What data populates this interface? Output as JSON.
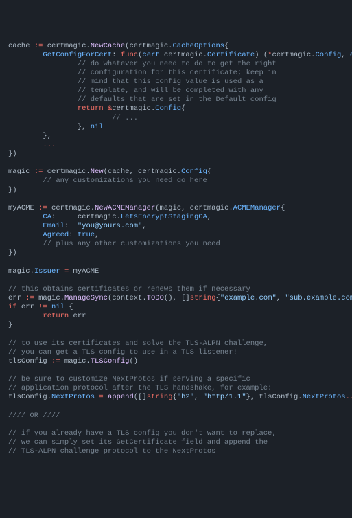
{
  "tokens": [
    {
      "cls": "p",
      "t": "cache "
    },
    {
      "cls": "k",
      "t": ":="
    },
    {
      "cls": "p",
      "t": " certmagic."
    },
    {
      "cls": "fn",
      "t": "NewCache"
    },
    {
      "cls": "p",
      "t": "(certmagic."
    },
    {
      "cls": "v",
      "t": "CacheOptions"
    },
    {
      "cls": "p",
      "t": "{\n"
    },
    {
      "cls": "p",
      "t": "        "
    },
    {
      "cls": "v",
      "t": "GetConfigForCert"
    },
    {
      "cls": "p",
      "t": ": "
    },
    {
      "cls": "k",
      "t": "func"
    },
    {
      "cls": "p",
      "t": "("
    },
    {
      "cls": "v",
      "t": "cert"
    },
    {
      "cls": "p",
      "t": " certmagic."
    },
    {
      "cls": "v",
      "t": "Certificate"
    },
    {
      "cls": "p",
      "t": ") ("
    },
    {
      "cls": "k",
      "t": "*"
    },
    {
      "cls": "p",
      "t": "certmagic."
    },
    {
      "cls": "v",
      "t": "Config"
    },
    {
      "cls": "p",
      "t": ", "
    },
    {
      "cls": "v",
      "t": "error"
    },
    {
      "cls": "p",
      "t": ") {\n"
    },
    {
      "cls": "p",
      "t": "                "
    },
    {
      "cls": "c",
      "t": "// do whatever you need to do to get the right"
    },
    {
      "cls": "p",
      "t": "\n"
    },
    {
      "cls": "p",
      "t": "                "
    },
    {
      "cls": "c",
      "t": "// configuration for this certificate; keep in"
    },
    {
      "cls": "p",
      "t": "\n"
    },
    {
      "cls": "p",
      "t": "                "
    },
    {
      "cls": "c",
      "t": "// mind that this config value is used as a"
    },
    {
      "cls": "p",
      "t": "\n"
    },
    {
      "cls": "p",
      "t": "                "
    },
    {
      "cls": "c",
      "t": "// template, and will be completed with any"
    },
    {
      "cls": "p",
      "t": "\n"
    },
    {
      "cls": "p",
      "t": "                "
    },
    {
      "cls": "c",
      "t": "// defaults that are set in the Default config"
    },
    {
      "cls": "p",
      "t": "\n"
    },
    {
      "cls": "p",
      "t": "                "
    },
    {
      "cls": "k",
      "t": "return"
    },
    {
      "cls": "p",
      "t": " "
    },
    {
      "cls": "k",
      "t": "&"
    },
    {
      "cls": "p",
      "t": "certmagic."
    },
    {
      "cls": "v",
      "t": "Config"
    },
    {
      "cls": "p",
      "t": "{\n"
    },
    {
      "cls": "p",
      "t": "                        "
    },
    {
      "cls": "c",
      "t": "// ..."
    },
    {
      "cls": "p",
      "t": "\n"
    },
    {
      "cls": "p",
      "t": "                }, "
    },
    {
      "cls": "n",
      "t": "nil"
    },
    {
      "cls": "p",
      "t": "\n"
    },
    {
      "cls": "p",
      "t": "        },\n"
    },
    {
      "cls": "p",
      "t": "        "
    },
    {
      "cls": "k",
      "t": "..."
    },
    {
      "cls": "p",
      "t": "\n"
    },
    {
      "cls": "p",
      "t": "})\n"
    },
    {
      "cls": "p",
      "t": "\n"
    },
    {
      "cls": "p",
      "t": "magic "
    },
    {
      "cls": "k",
      "t": ":="
    },
    {
      "cls": "p",
      "t": " certmagic."
    },
    {
      "cls": "fn",
      "t": "New"
    },
    {
      "cls": "p",
      "t": "(cache, certmagic."
    },
    {
      "cls": "v",
      "t": "Config"
    },
    {
      "cls": "p",
      "t": "{\n"
    },
    {
      "cls": "p",
      "t": "        "
    },
    {
      "cls": "c",
      "t": "// any customizations you need go here"
    },
    {
      "cls": "p",
      "t": "\n"
    },
    {
      "cls": "p",
      "t": "})\n"
    },
    {
      "cls": "p",
      "t": "\n"
    },
    {
      "cls": "p",
      "t": "myACME "
    },
    {
      "cls": "k",
      "t": ":="
    },
    {
      "cls": "p",
      "t": " certmagic."
    },
    {
      "cls": "fn",
      "t": "NewACMEManager"
    },
    {
      "cls": "p",
      "t": "(magic, certmagic."
    },
    {
      "cls": "v",
      "t": "ACMEManager"
    },
    {
      "cls": "p",
      "t": "{\n"
    },
    {
      "cls": "p",
      "t": "        "
    },
    {
      "cls": "v",
      "t": "CA"
    },
    {
      "cls": "p",
      "t": ":     certmagic."
    },
    {
      "cls": "v",
      "t": "LetsEncryptStagingCA"
    },
    {
      "cls": "p",
      "t": ",\n"
    },
    {
      "cls": "p",
      "t": "        "
    },
    {
      "cls": "v",
      "t": "Email"
    },
    {
      "cls": "p",
      "t": ":  "
    },
    {
      "cls": "s",
      "t": "\"you@yours.com\""
    },
    {
      "cls": "p",
      "t": ",\n"
    },
    {
      "cls": "p",
      "t": "        "
    },
    {
      "cls": "v",
      "t": "Agreed"
    },
    {
      "cls": "p",
      "t": ": "
    },
    {
      "cls": "n",
      "t": "true"
    },
    {
      "cls": "p",
      "t": ",\n"
    },
    {
      "cls": "p",
      "t": "        "
    },
    {
      "cls": "c",
      "t": "// plus any other customizations you need"
    },
    {
      "cls": "p",
      "t": "\n"
    },
    {
      "cls": "p",
      "t": "})\n"
    },
    {
      "cls": "p",
      "t": "\n"
    },
    {
      "cls": "p",
      "t": "magic."
    },
    {
      "cls": "v",
      "t": "Issuer"
    },
    {
      "cls": "p",
      "t": " "
    },
    {
      "cls": "k",
      "t": "="
    },
    {
      "cls": "p",
      "t": " myACME\n"
    },
    {
      "cls": "p",
      "t": "\n"
    },
    {
      "cls": "c",
      "t": "// this obtains certificates or renews them if necessary"
    },
    {
      "cls": "p",
      "t": "\n"
    },
    {
      "cls": "p",
      "t": "err "
    },
    {
      "cls": "k",
      "t": ":="
    },
    {
      "cls": "p",
      "t": " magic."
    },
    {
      "cls": "fn",
      "t": "ManageSync"
    },
    {
      "cls": "p",
      "t": "(context."
    },
    {
      "cls": "fn",
      "t": "TODO"
    },
    {
      "cls": "p",
      "t": "(), []"
    },
    {
      "cls": "k",
      "t": "string"
    },
    {
      "cls": "p",
      "t": "{"
    },
    {
      "cls": "s",
      "t": "\"example.com\""
    },
    {
      "cls": "p",
      "t": ", "
    },
    {
      "cls": "s",
      "t": "\"sub.example.com\""
    },
    {
      "cls": "p",
      "t": "})\n"
    },
    {
      "cls": "k",
      "t": "if"
    },
    {
      "cls": "p",
      "t": " err "
    },
    {
      "cls": "k",
      "t": "!="
    },
    {
      "cls": "p",
      "t": " "
    },
    {
      "cls": "n",
      "t": "nil"
    },
    {
      "cls": "p",
      "t": " {\n"
    },
    {
      "cls": "p",
      "t": "        "
    },
    {
      "cls": "k",
      "t": "return"
    },
    {
      "cls": "p",
      "t": " err\n"
    },
    {
      "cls": "p",
      "t": "}\n"
    },
    {
      "cls": "p",
      "t": "\n"
    },
    {
      "cls": "c",
      "t": "// to use its certificates and solve the TLS-ALPN challenge,"
    },
    {
      "cls": "p",
      "t": "\n"
    },
    {
      "cls": "c",
      "t": "// you can get a TLS config to use in a TLS listener!"
    },
    {
      "cls": "p",
      "t": "\n"
    },
    {
      "cls": "p",
      "t": "tlsConfig "
    },
    {
      "cls": "k",
      "t": ":="
    },
    {
      "cls": "p",
      "t": " magic."
    },
    {
      "cls": "fn",
      "t": "TLSConfig"
    },
    {
      "cls": "p",
      "t": "()\n"
    },
    {
      "cls": "p",
      "t": "\n"
    },
    {
      "cls": "c",
      "t": "// be sure to customize NextProtos if serving a specific"
    },
    {
      "cls": "p",
      "t": "\n"
    },
    {
      "cls": "c",
      "t": "// application protocol after the TLS handshake, for example:"
    },
    {
      "cls": "p",
      "t": "\n"
    },
    {
      "cls": "p",
      "t": "tlsConfig."
    },
    {
      "cls": "v",
      "t": "NextProtos"
    },
    {
      "cls": "p",
      "t": " "
    },
    {
      "cls": "k",
      "t": "="
    },
    {
      "cls": "p",
      "t": " "
    },
    {
      "cls": "fn",
      "t": "append"
    },
    {
      "cls": "p",
      "t": "([]"
    },
    {
      "cls": "k",
      "t": "string"
    },
    {
      "cls": "p",
      "t": "{"
    },
    {
      "cls": "s",
      "t": "\"h2\""
    },
    {
      "cls": "p",
      "t": ", "
    },
    {
      "cls": "s",
      "t": "\"http/1.1\""
    },
    {
      "cls": "p",
      "t": "}, tlsConfig."
    },
    {
      "cls": "v",
      "t": "NextProtos"
    },
    {
      "cls": "k",
      "t": "..."
    },
    {
      "cls": "p",
      "t": ")\n"
    },
    {
      "cls": "p",
      "t": "\n"
    },
    {
      "cls": "c",
      "t": "//// OR ////"
    },
    {
      "cls": "p",
      "t": "\n"
    },
    {
      "cls": "p",
      "t": "\n"
    },
    {
      "cls": "c",
      "t": "// if you already have a TLS config you don't want to replace,"
    },
    {
      "cls": "p",
      "t": "\n"
    },
    {
      "cls": "c",
      "t": "// we can simply set its GetCertificate field and append the"
    },
    {
      "cls": "p",
      "t": "\n"
    },
    {
      "cls": "c",
      "t": "// TLS-ALPN challenge protocol to the NextProtos"
    },
    {
      "cls": "p",
      "t": "\n"
    }
  ]
}
